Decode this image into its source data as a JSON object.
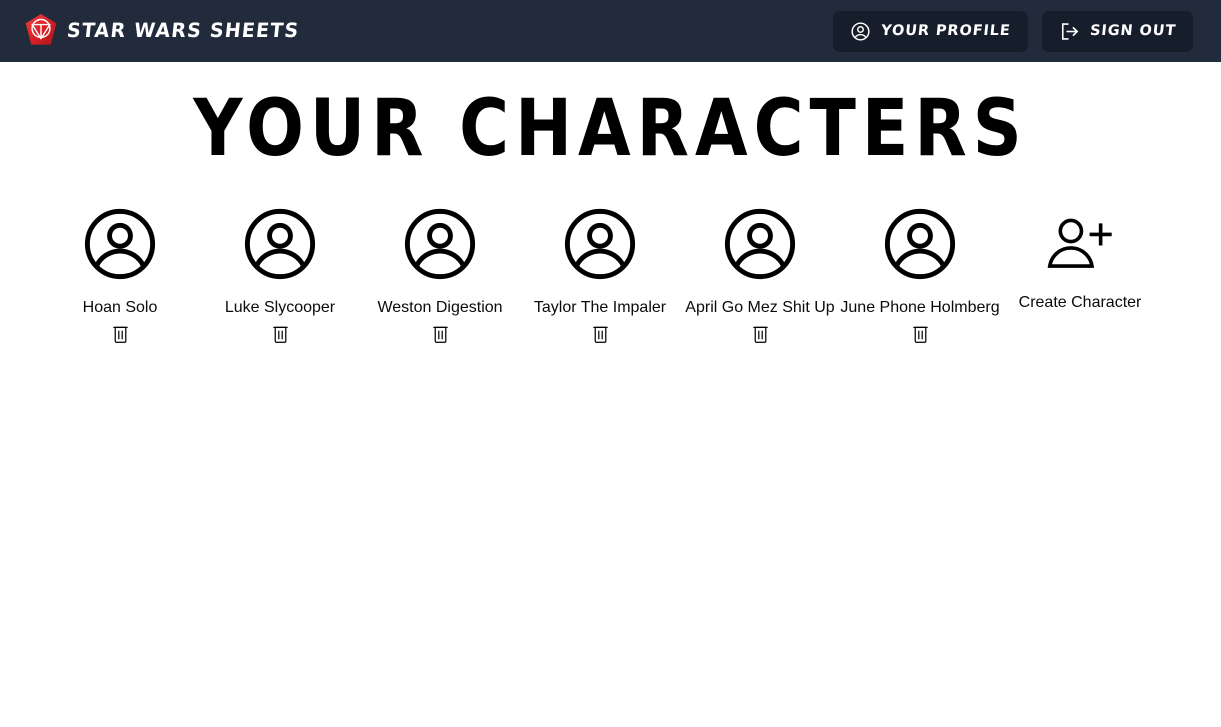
{
  "navbar": {
    "brand": {
      "text": "STAR WARS SHEETS",
      "logo_icon": "empire-shield-icon",
      "logo_color": "#e0232b"
    },
    "buttons": [
      {
        "label": "YOUR PROFILE",
        "icon": "user-circle-icon"
      },
      {
        "label": "SIGN OUT",
        "icon": "sign-out-icon"
      }
    ],
    "background_color": "#222b3c",
    "button_background_color": "#161d2b"
  },
  "main": {
    "title": "YOUR CHARACTERS",
    "delete_icon": "trash-icon",
    "avatar_icon": "circle-user-icon",
    "characters": [
      {
        "name": "Hoan Solo"
      },
      {
        "name": "Luke Slycooper"
      },
      {
        "name": "Weston Digestion"
      },
      {
        "name": "Taylor The Impaler"
      },
      {
        "name": "April Go Mez Shit Up"
      },
      {
        "name": "June Phone Holmberg"
      }
    ],
    "create": {
      "label": "Create Character",
      "icon": "user-plus-icon"
    }
  }
}
